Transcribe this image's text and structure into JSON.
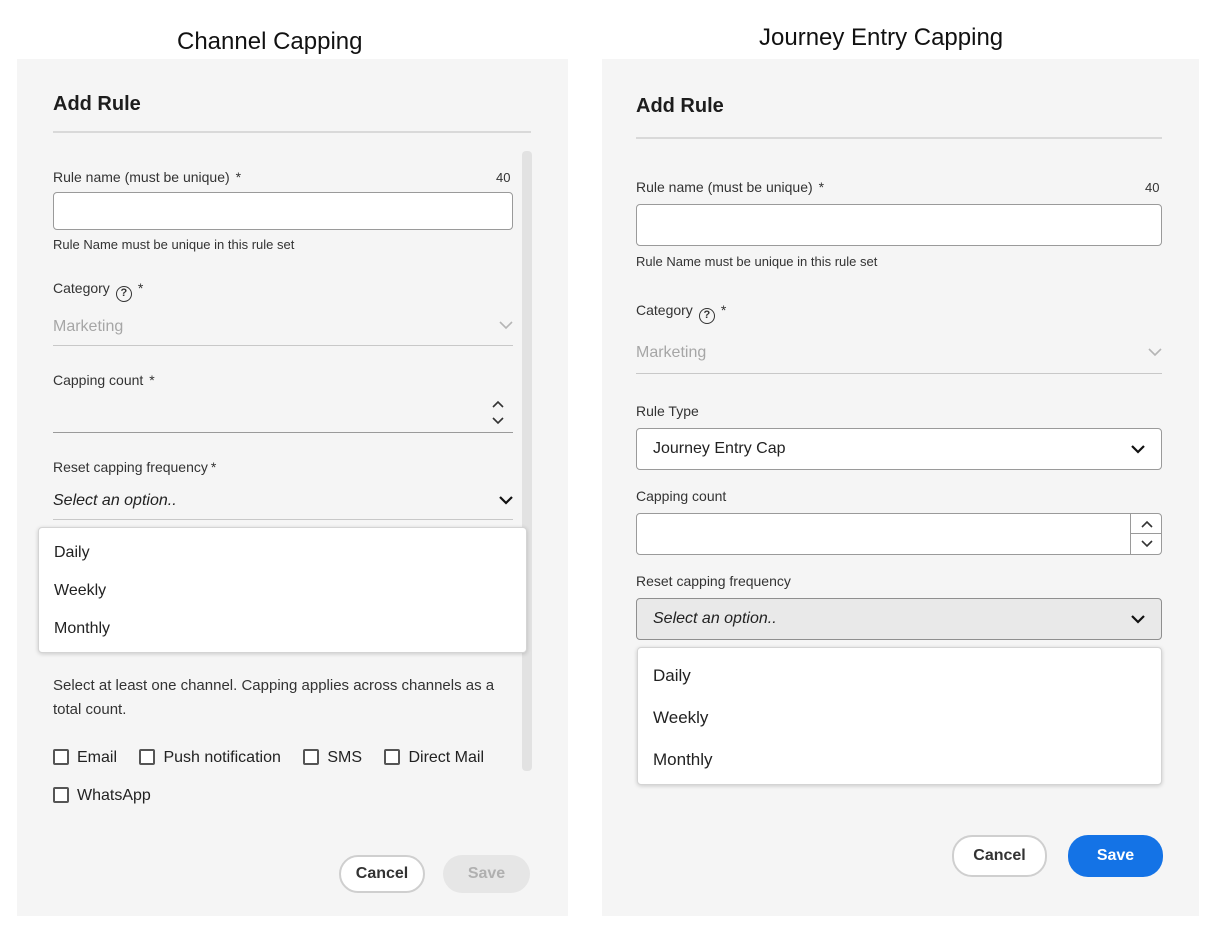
{
  "captions": {
    "left": "Channel Capping",
    "right": "Journey Entry Capping"
  },
  "left": {
    "title": "Add Rule",
    "rule_name_label": "Rule name (must be unique)",
    "required_mark": "*",
    "rule_name_counter": "40",
    "rule_name_value": "",
    "rule_name_help": "Rule Name must be unique in this rule set",
    "category_label": "Category",
    "category_value": "Marketing",
    "capping_count_label": "Capping count",
    "reset_label": "Reset capping frequency",
    "reset_placeholder": "Select an option..",
    "menu": [
      "Daily",
      "Weekly",
      "Monthly"
    ],
    "channel_help": "Select at least one channel. Capping applies across channels as a total count.",
    "channels": [
      "Email",
      "Push notification",
      "SMS",
      "Direct Mail",
      "WhatsApp"
    ],
    "cancel_label": "Cancel",
    "save_label": "Save"
  },
  "right": {
    "title": "Add Rule",
    "rule_name_label": "Rule name (must be unique)",
    "required_mark": "*",
    "rule_name_counter": "40",
    "rule_name_value": "",
    "rule_name_help": "Rule Name must be unique in this rule set",
    "category_label": "Category",
    "category_value": "Marketing",
    "rule_type_label": "Rule Type",
    "rule_type_value": "Journey Entry Cap",
    "capping_count_label": "Capping count",
    "reset_label": "Reset capping frequency",
    "reset_placeholder": "Select an option..",
    "menu": [
      "Daily",
      "Weekly",
      "Monthly"
    ],
    "cancel_label": "Cancel",
    "save_label": "Save"
  }
}
